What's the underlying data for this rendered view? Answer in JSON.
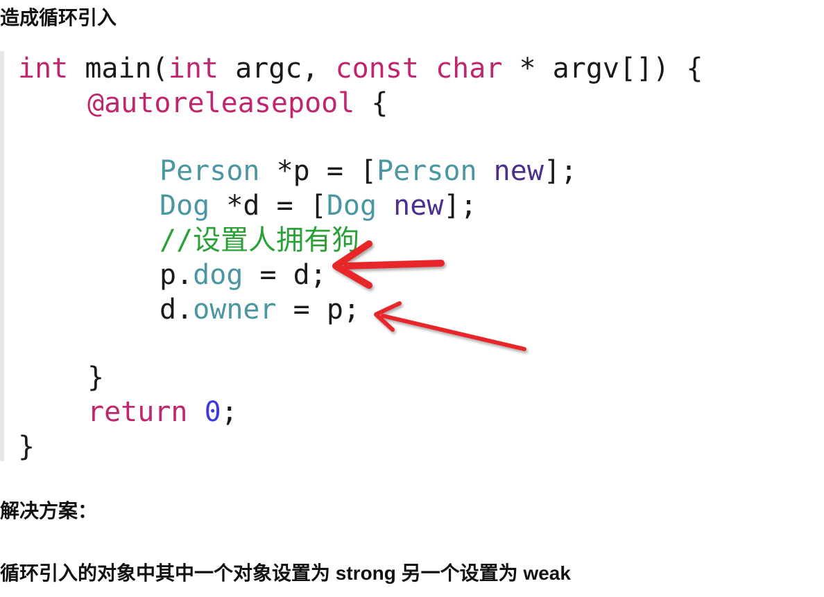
{
  "headings": {
    "cause": "造成循环引入",
    "solution_label": "解决方案：",
    "solution_text": "循环引入的对象中其中一个对象设置为 strong  另一个设置为 weak"
  },
  "code": {
    "l1": {
      "kw1": "int",
      "t1": " main(",
      "kw2": "int",
      "t2": " argc, ",
      "kw3": "const",
      "t3": " ",
      "kw4": "char",
      "t4": " * argv[]) {"
    },
    "l2": {
      "kw": "@autoreleasepool",
      "t": " {"
    },
    "l4": {
      "cls1": "Person",
      "t1": " *p = [",
      "cls2": "Person",
      "t2": " ",
      "msg": "new",
      "t3": "];"
    },
    "l5": {
      "cls1": "Dog",
      "t1": " *d = [",
      "cls2": "Dog",
      "t2": " ",
      "msg": "new",
      "t3": "];"
    },
    "l6": {
      "comment": "//设置人拥有狗"
    },
    "l7": {
      "t1": "p.",
      "prop": "dog",
      "t2": " = d;"
    },
    "l8": {
      "t1": "d.",
      "prop": "owner",
      "t2": " = p;"
    },
    "l10": {
      "t": "}"
    },
    "l11": {
      "kw": "return",
      "t1": " ",
      "num": "0",
      "t2": ";"
    },
    "l12": {
      "t": "}"
    }
  },
  "colors": {
    "keyword": "#c0256e",
    "class": "#4a97a1",
    "method": "#4d2f8f",
    "number": "#3a3ae0",
    "comment": "#2aa137",
    "arrow": "#e8262a"
  }
}
